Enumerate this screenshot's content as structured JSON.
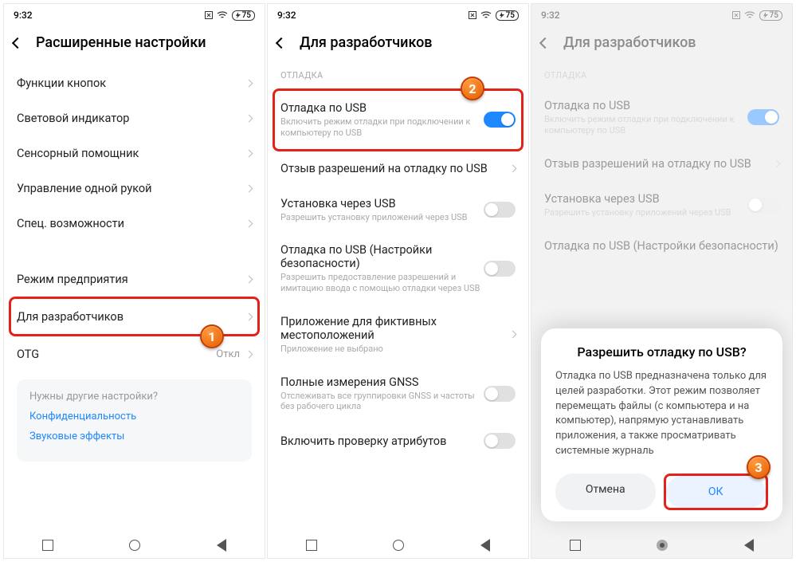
{
  "status": {
    "time": "9:32",
    "battery": "75"
  },
  "markers": {
    "m1": "1",
    "m2": "2",
    "m3": "3"
  },
  "p1": {
    "title": "Расширенные настройки",
    "rows": {
      "r1": "Функции кнопок",
      "r2": "Световой индикатор",
      "r3": "Сенсорный помощник",
      "r4": "Управление одной рукой",
      "r5": "Спец. возможности",
      "r6": "Режим предприятия",
      "r7": "Для разработчиков",
      "r8": "OTG",
      "r8v": "Откл"
    },
    "card": {
      "q": "Нужны другие настройки?",
      "l1": "Конфиденциальность",
      "l2": "Звуковые эффекты"
    }
  },
  "p2": {
    "title": "Для разработчиков",
    "section": "ОТЛАДКА",
    "r1": {
      "t": "Отладка по USB",
      "s": "Включить режим отладки при подключении к компьютеру по USB"
    },
    "r2": {
      "t": "Отзыв разрешений на отладку по USB"
    },
    "r3": {
      "t": "Установка через USB",
      "s": "Разрешить установку приложений через USB"
    },
    "r4": {
      "t": "Отладка по USB (Настройки безопасности)",
      "s": "Разрешить предоставление разрешений и имитацию ввода с помощью отладки через USB"
    },
    "r5": {
      "t": "Приложение для фиктивных местоположений",
      "s": "Приложение не выбрано"
    },
    "r6": {
      "t": "Полные измерения GNSS",
      "s": "Отслеживать все группировки GNSS и частоты без рабочего цикла"
    },
    "r7": {
      "t": "Включить проверку атрибутов"
    }
  },
  "p3": {
    "title": "Для разработчиков",
    "dialog": {
      "title": "Разрешить отладку по USB?",
      "body": "Отладка по USB предназначена только для целей разработки. Этот режим позволяет перемещать файлы (с компьютера и на компьютер), напрямую устанавливать приложения, а также просматривать системные журналь",
      "cancel": "Отмена",
      "ok": "ОК"
    }
  }
}
